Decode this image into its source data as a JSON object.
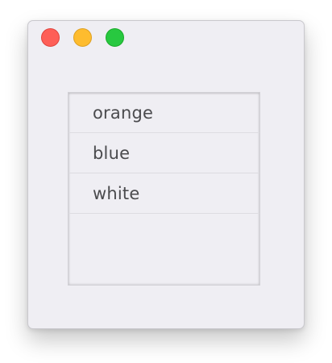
{
  "window": {
    "controls": [
      {
        "name": "close",
        "color": "#fe5f57"
      },
      {
        "name": "minimize",
        "color": "#febc2e"
      },
      {
        "name": "zoom",
        "color": "#28c840"
      }
    ]
  },
  "list": {
    "items": [
      {
        "label": "orange"
      },
      {
        "label": "blue"
      },
      {
        "label": "white"
      }
    ]
  }
}
